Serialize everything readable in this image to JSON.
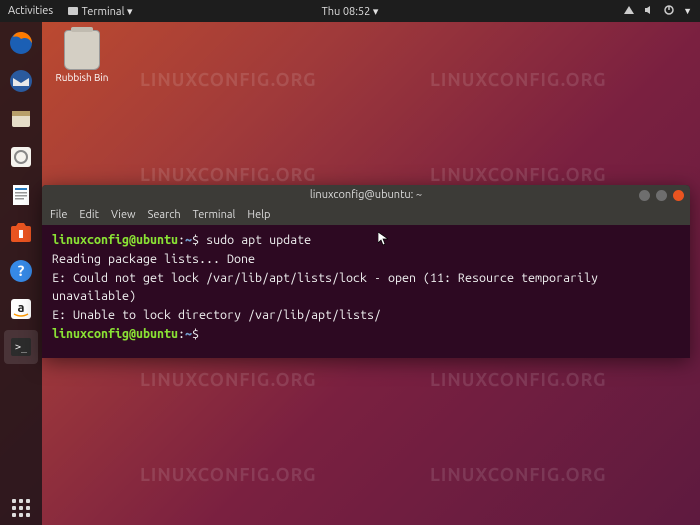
{
  "topbar": {
    "activities": "Activities",
    "app_menu": "Terminal ▾",
    "clock": "Thu 08:52"
  },
  "desktop": {
    "trash_label": "Rubbish Bin"
  },
  "terminal": {
    "title": "linuxconfig@ubuntu: ~",
    "menu": {
      "file": "File",
      "edit": "Edit",
      "view": "View",
      "search": "Search",
      "terminal": "Terminal",
      "help": "Help"
    },
    "session": {
      "prompt_user_host": "linuxconfig@ubuntu",
      "prompt_sep": ":",
      "prompt_path": "~",
      "prompt_char": "$",
      "lines": [
        {
          "cmd": "sudo apt update"
        },
        {
          "out": "Reading package lists... Done"
        },
        {
          "out": "E: Could not get lock /var/lib/apt/lists/lock - open (11: Resource temporarily unavailable)"
        },
        {
          "out": "E: Unable to lock directory /var/lib/apt/lists/"
        }
      ]
    }
  },
  "watermark": "LINUXCONFIG.ORG"
}
